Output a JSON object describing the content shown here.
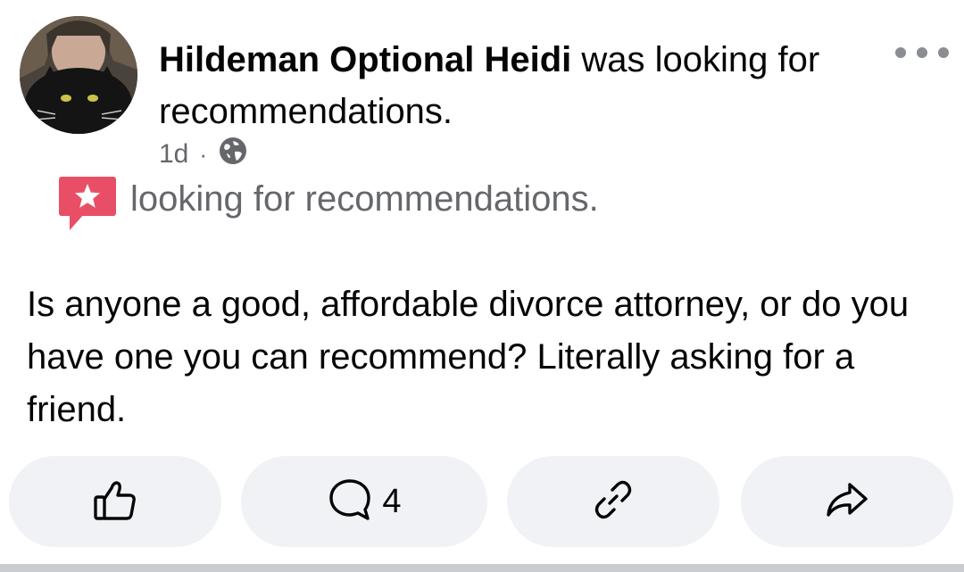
{
  "post": {
    "author": "Hildeman Optional Heidi",
    "status": "was looking for recommendations.",
    "time": "1d",
    "separator": "·",
    "audience_icon": "globe-icon",
    "activity_icon": "star-speech-bubble-icon",
    "activity_text": "looking for recommendations.",
    "body": "Is anyone a good, affordable divorce attorney, or do you have one you can recommend? Literally asking for a friend.",
    "more_icon": "ellipsis-icon"
  },
  "actions": {
    "like_icon": "thumbs-up-icon",
    "comment_icon": "comment-icon",
    "comment_count": "4",
    "link_icon": "link-icon",
    "share_icon": "share-arrow-icon"
  },
  "colors": {
    "activity_badge": "#e84f66",
    "pill_bg": "#f0f2f5",
    "secondary_text": "#65676b"
  }
}
